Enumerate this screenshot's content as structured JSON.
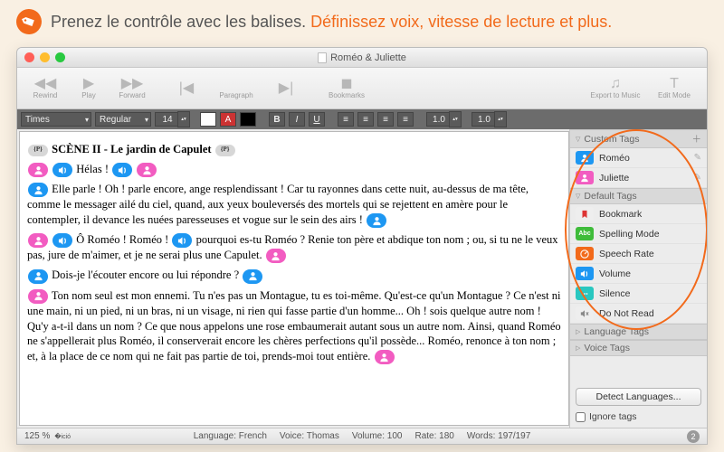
{
  "banner": {
    "text_plain": "Prenez le contrôle avec les balises. ",
    "text_highlight": "Définissez voix, vitesse de lecture et plus."
  },
  "window": {
    "title": "Roméo & Juliette"
  },
  "toolbar": {
    "rewind": "Rewind",
    "play": "Play",
    "forward": "Forward",
    "paragraph": "Paragraph",
    "bookmarks": "Bookmarks",
    "export": "Export to Music",
    "edit": "Edit Mode"
  },
  "formatbar": {
    "font": "Times",
    "weight": "Regular",
    "size": "14",
    "fg": "#ffffff",
    "bg": "#000000",
    "b": "B",
    "i": "I",
    "u": "U",
    "num1": "1.0",
    "num2": "1.0"
  },
  "document": {
    "heading": "SCÈNE II - Le jardin de Capulet",
    "p1": "Hélas !",
    "p2": "Elle parle ! Oh ! parle encore, ange resplendissant ! Car tu rayonnes dans cette nuit, au-dessus de ma tête, comme le messager ailé du ciel, quand, aux yeux bouleversés des mortels qui se rejettent en amère pour le contempler, il devance les nuées paresseuses et vogue sur le sein des airs !",
    "p3a": "Ô Roméo ! Roméo !",
    "p3b": "pourquoi es-tu Roméo ? Renie ton père et abdique ton nom ; ou, si tu ne le veux pas, jure de m'aimer, et je ne serai plus une Capulet.",
    "p4": "Dois-je l'écouter encore ou lui répondre ?",
    "p5": "Ton nom seul est mon ennemi. Tu n'es pas un Montague, tu es toi-même. Qu'est-ce qu'un Montague ? Ce n'est ni une main, ni un pied, ni un bras, ni un visage, ni rien qui fasse partie d'un homme... Oh ! sois quelque autre nom ! Qu'y a-t-il dans un nom ? Ce que nous appelons une rose embaumerait autant sous un autre nom. Ainsi, quand Roméo ne s'appellerait plus Roméo, il conserverait encore les chères perfections qu'il possède... Roméo, renonce à ton nom ; et, à la place de ce nom qui ne fait pas partie de toi, prends-moi tout entière."
  },
  "sidebar": {
    "custom_header": "Custom Tags",
    "default_header": "Default Tags",
    "language_header": "Language Tags",
    "voice_header": "Voice Tags",
    "custom": [
      {
        "label": "Roméo",
        "color": "#1d97f2",
        "icon": "person"
      },
      {
        "label": "Juliette",
        "color": "#f25cc1",
        "icon": "person"
      }
    ],
    "default": [
      {
        "label": "Bookmark",
        "color": "#e9e9e9",
        "icon": "bookmark"
      },
      {
        "label": "Spelling Mode",
        "color": "#3fbc3a",
        "icon": "abc"
      },
      {
        "label": "Speech Rate",
        "color": "#f26a1b",
        "icon": "gauge"
      },
      {
        "label": "Volume",
        "color": "#1d97f2",
        "icon": "volume"
      },
      {
        "label": "Silence",
        "color": "#29c7c0",
        "icon": "dots"
      },
      {
        "label": "Do Not Read",
        "color": "#e9e9e9",
        "icon": "mute"
      }
    ],
    "detect": "Detect Languages...",
    "ignore": "Ignore tags"
  },
  "status": {
    "zoom": "125 %",
    "language_label": "Language:",
    "language": "French",
    "voice_label": "Voice:",
    "voice": "Thomas",
    "volume_label": "Volume:",
    "volume": "100",
    "rate_label": "Rate:",
    "rate": "180",
    "words_label": "Words:",
    "words": "197/197",
    "badge": "2"
  }
}
